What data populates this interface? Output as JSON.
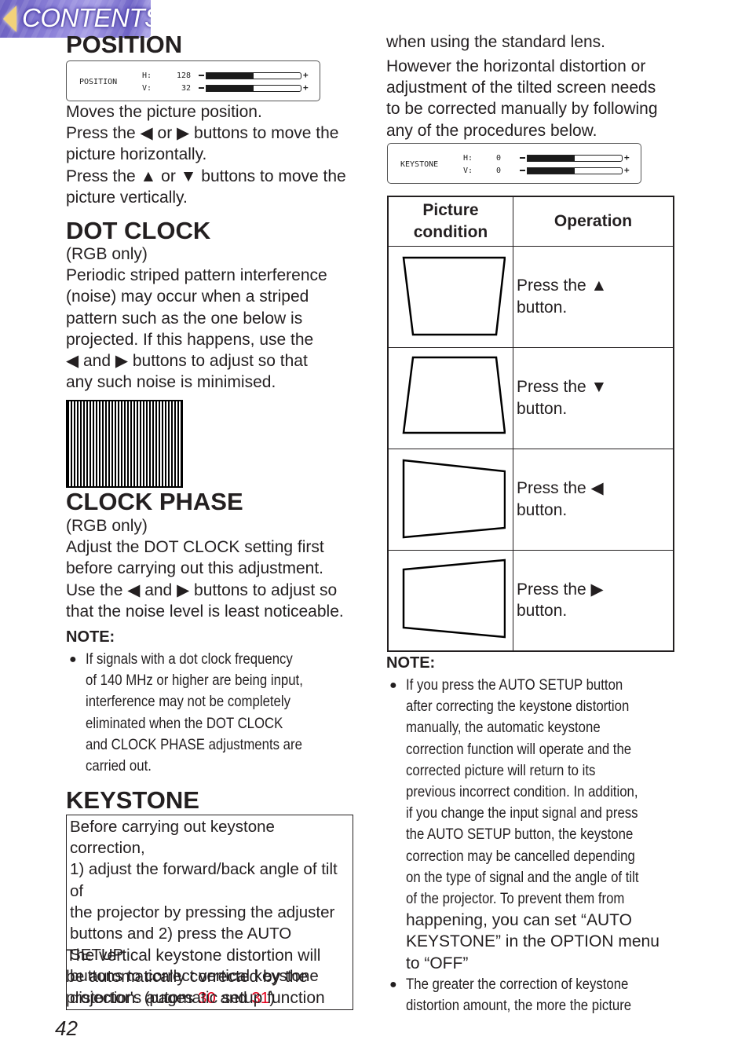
{
  "nav": {
    "contents_label": "CONTENTS",
    "arrow_icon": "left-triangle-icon",
    "arrow_color": "#f2d27a"
  },
  "position": {
    "title": "POSITION",
    "osd": {
      "label": "POSITION",
      "rows": [
        {
          "key": "H:",
          "value": "128",
          "fill_fraction": 0.5
        },
        {
          "key": "V:",
          "value": "32",
          "fill_fraction": 0.5
        }
      ]
    },
    "lines": [
      "Moves the picture position.",
      "Press the ◀ or ▶ buttons to move the",
      "picture horizontally.",
      "Press the ▲ or ▼ buttons to move the",
      "picture vertically."
    ]
  },
  "dot_clock": {
    "title": "DOT CLOCK",
    "subtitle": "(RGB only)",
    "lines": [
      "Periodic striped pattern interference",
      "(noise) may occur when a striped",
      "pattern such as the one below is",
      "projected. If this happens, use the",
      "◀ and ▶ buttons to adjust so that",
      "any such noise is minimised."
    ]
  },
  "clock_phase": {
    "title": "CLOCK PHASE",
    "subtitle": "(RGB only)",
    "lines": [
      "Adjust the DOT CLOCK setting first",
      "before carrying out this adjustment.",
      "Use the ◀ and ▶ buttons to adjust so",
      "that the noise level is least noticeable."
    ],
    "note_title": "NOTE:",
    "notes": [
      [
        "If signals with a dot clock frequency",
        "of 140 MHz or higher are being input,",
        "interference may not be completely",
        "eliminated when the DOT CLOCK",
        "and CLOCK PHASE adjustments are",
        "carried out."
      ]
    ]
  },
  "keystone": {
    "title": "KEYSTONE",
    "box_lines": [
      "Before carrying out keystone correction,",
      "1) adjust the forward/back angle of tilt of",
      "the projector by pressing the adjuster",
      "buttons and 2) press the AUTO SETUP",
      "buttons to correct vertical keystone"
    ],
    "box_last_prefix": "distortion. (pages ",
    "page_ref_1": "30",
    "box_last_middle": " and ",
    "page_ref_2": "31",
    "box_last_suffix": ")",
    "link_color": "#e3001b",
    "after_lines": [
      "The vertical keystone distortion will",
      "be automatically corrected by the",
      "projector's automatic setup function"
    ],
    "right_lines_1": [
      "when using the standard lens."
    ],
    "right_lines_2": [
      "However the horizontal distortion or",
      "adjustment of the tilted screen needs",
      "to be corrected manually by following",
      "any of the procedures below."
    ],
    "osd": {
      "label": "KEYSTONE",
      "rows": [
        {
          "key": "H:",
          "value": "0",
          "fill_fraction": 0.5
        },
        {
          "key": "V:",
          "value": "0",
          "fill_fraction": 0.5
        }
      ]
    },
    "table": {
      "headers": [
        "Picture\ncondition",
        "Operation"
      ],
      "header_1_line1": "Picture",
      "header_1_line2": "condition",
      "header_2": "Operation",
      "rows": [
        {
          "shape": "wide-top-trapezoid",
          "op_line1": "Press the ▲",
          "op_line2": "button."
        },
        {
          "shape": "wide-bottom-trapezoid",
          "op_line1": "Press the ▼",
          "op_line2": "button."
        },
        {
          "shape": "tall-left-trapezoid",
          "op_line1": "Press the ◀",
          "op_line2": "button."
        },
        {
          "shape": "tall-right-trapezoid",
          "op_line1": "Press the ▶",
          "op_line2": "button."
        }
      ]
    },
    "note_title": "NOTE:",
    "notes": [
      [
        "If you press the AUTO SETUP button",
        "after correcting the keystone distortion",
        "manually, the automatic keystone",
        "correction function will operate and the",
        "corrected picture will return to its",
        "previous incorrect condition. In addition,",
        "if you change the input signal and press",
        "the AUTO SETUP button, the keystone",
        "correction may be cancelled depending",
        "on the type of signal and the angle of tilt",
        "of the projector. To prevent them from",
        "happening, you can set “AUTO",
        "KEYSTONE” in the OPTION menu",
        "to “OFF”"
      ],
      [
        "The greater the correction of keystone",
        "distortion amount, the more the picture"
      ]
    ]
  },
  "footer": {
    "page_number": "42"
  }
}
